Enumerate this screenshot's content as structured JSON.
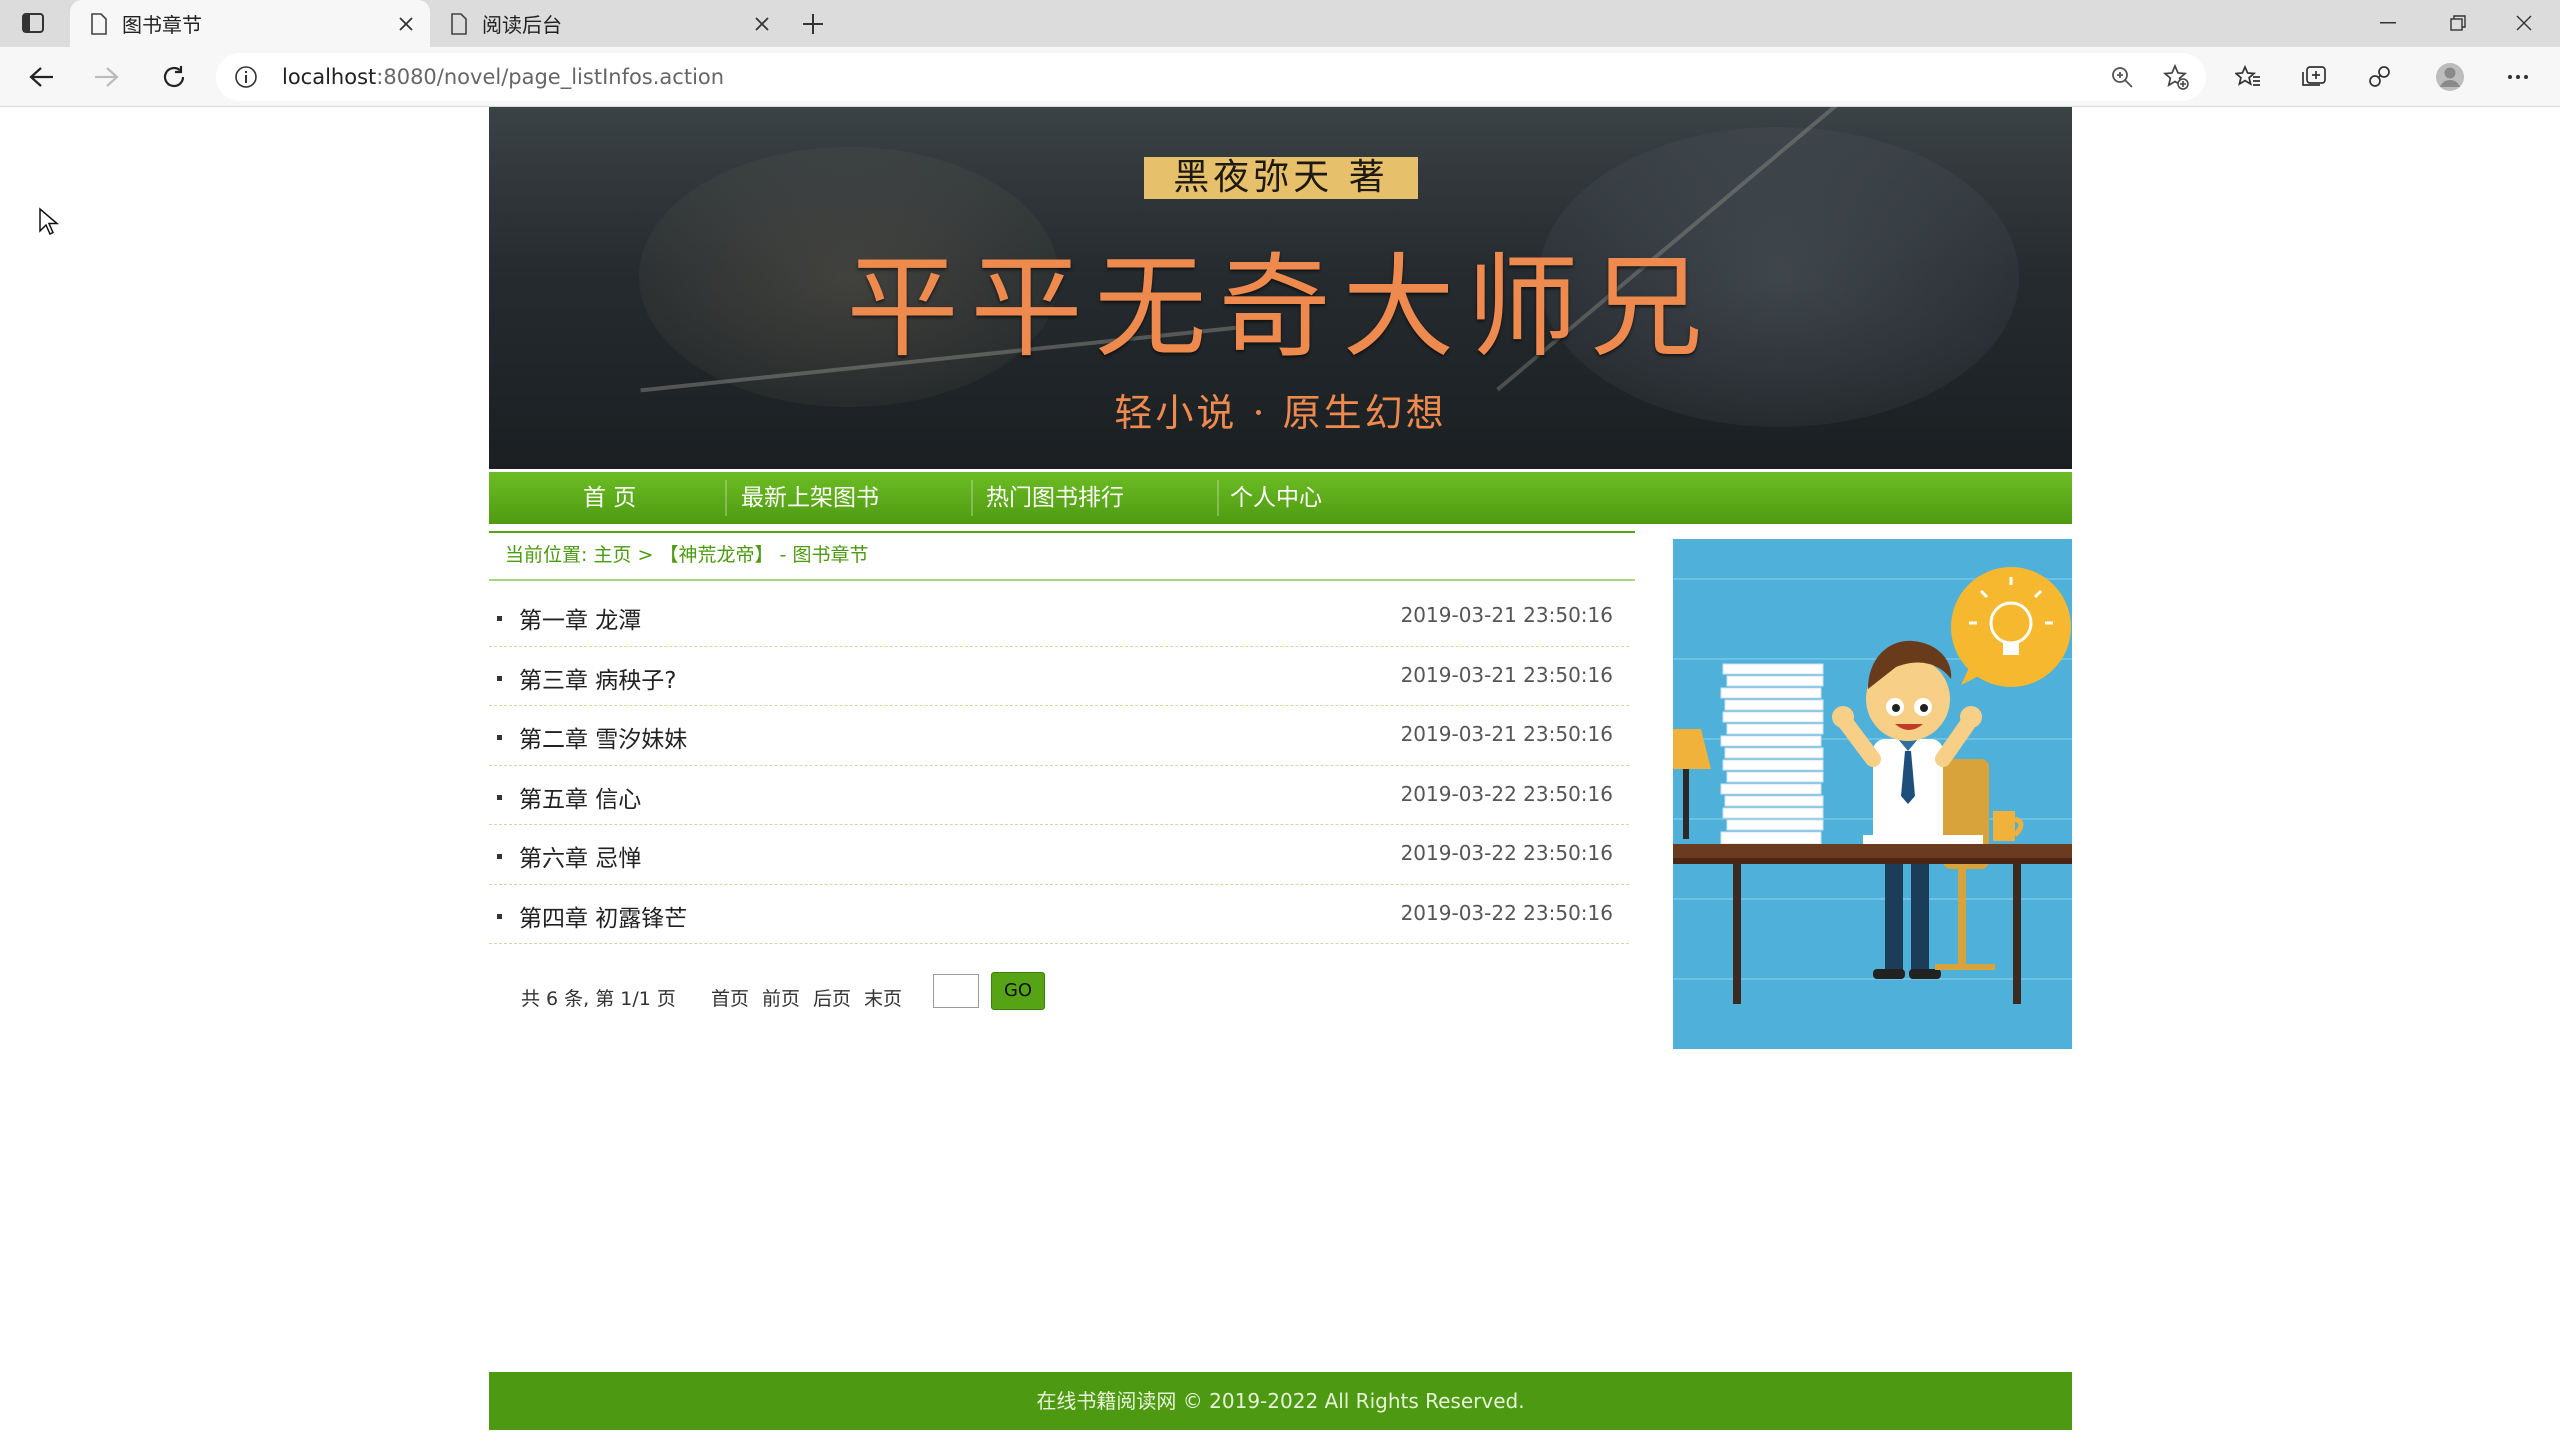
{
  "browser": {
    "tabs": [
      {
        "title": "图书章节",
        "active": true
      },
      {
        "title": "阅读后台",
        "active": false
      }
    ],
    "url_host": "localhost",
    "url_rest": ":8080/novel/page_listInfos.action",
    "colors": {
      "tabbar": "#dcdcdc",
      "toolbar": "#f7f7f7"
    }
  },
  "banner": {
    "author": "黑夜弥天 著",
    "title": "平平无奇大师兄",
    "subtitle": "轻小说 · 原生幻想",
    "title_color": "#ef8a4e"
  },
  "nav": {
    "items": [
      {
        "label": "首 页"
      },
      {
        "label": "最新上架图书"
      },
      {
        "label": "热门图书排行"
      },
      {
        "label": "个人中心"
      }
    ],
    "color": "#5aa81a"
  },
  "breadcrumb": {
    "prefix": "当前位置:",
    "home": "主页",
    "sep": ">",
    "book": "【神荒龙帝】",
    "current": "- 图书章节"
  },
  "chapters": [
    {
      "title": "第一章 龙潭",
      "date": "2019-03-21 23:50:16"
    },
    {
      "title": "第三章 病秧子?",
      "date": "2019-03-21 23:50:16"
    },
    {
      "title": "第二章 雪汐妹妹",
      "date": "2019-03-21 23:50:16"
    },
    {
      "title": "第五章 信心",
      "date": "2019-03-22 23:50:16"
    },
    {
      "title": "第六章 忌惮",
      "date": "2019-03-22 23:50:16"
    },
    {
      "title": "第四章 初露锋芒",
      "date": "2019-03-22 23:50:16"
    }
  ],
  "pager": {
    "info": "共 6 条, 第 1/1 页",
    "first": "首页",
    "prev": "前页",
    "next": "后页",
    "last": "末页",
    "input_value": "",
    "go_label": "GO"
  },
  "footer": {
    "text": "在线书籍阅读网 © 2019-2022 All Rights Reserved."
  }
}
